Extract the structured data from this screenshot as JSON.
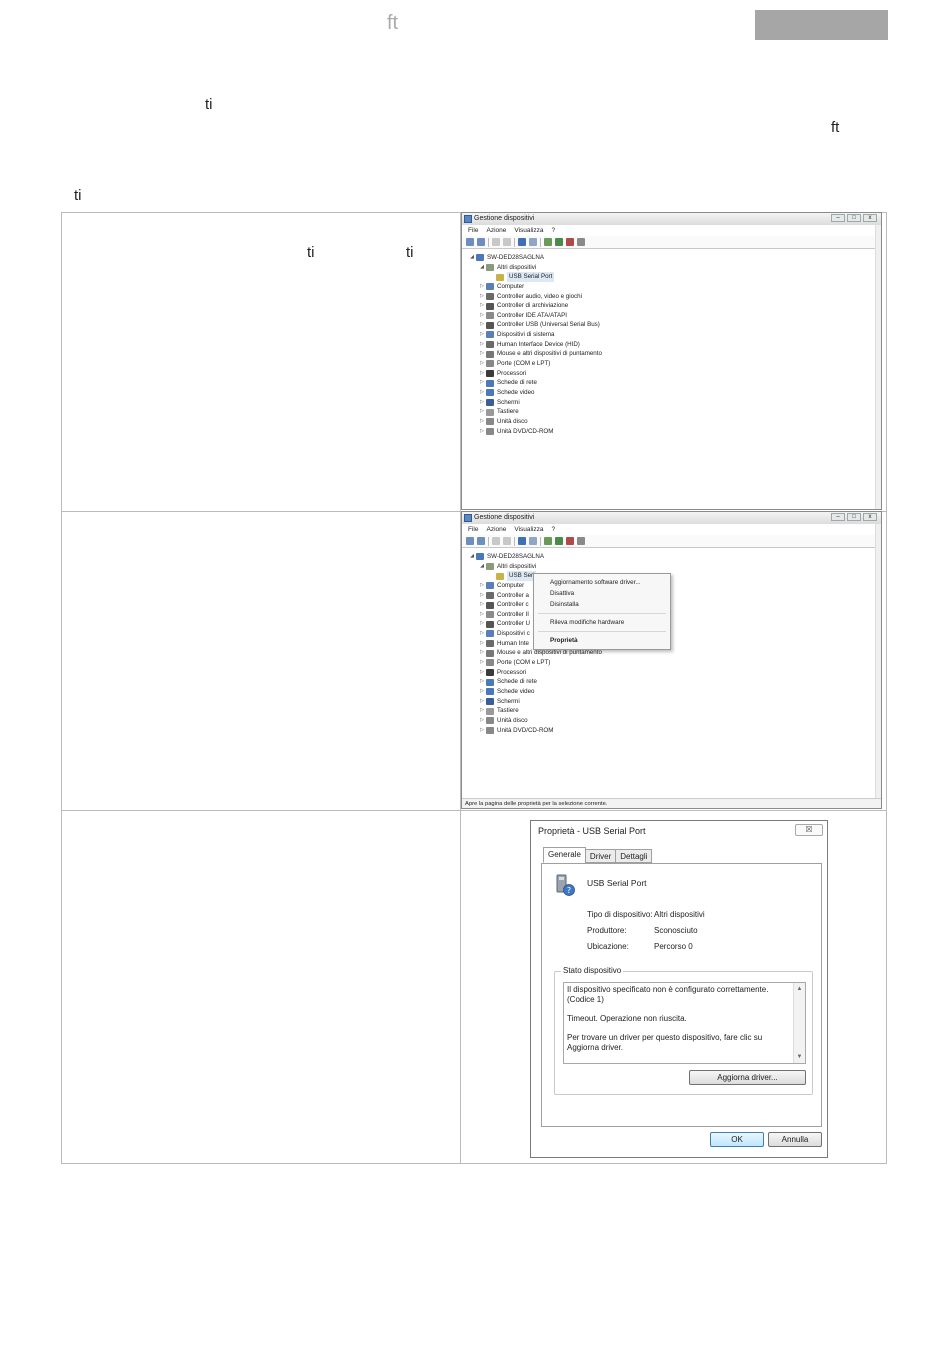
{
  "header": {
    "ft": "ft"
  },
  "fragments": {
    "ti1": "ti",
    "ft2": "ft",
    "ti2": "ti",
    "cell1_ti_a": "ti",
    "cell1_ti_b": "ti"
  },
  "window1": {
    "title": "Gestione dispositivi",
    "menu": [
      "File",
      "Azione",
      "Visualizza",
      "?"
    ],
    "tree": [
      {
        "level": 0,
        "toggle": "◢",
        "label": "SW-DED28SAGLNA",
        "color": "#4a78b8"
      },
      {
        "level": 1,
        "toggle": "◢",
        "label": "Altri dispositivi",
        "color": "#8a9a7a"
      },
      {
        "level": 2,
        "toggle": "",
        "label": "USB Serial Port",
        "color": "#c9b347"
      },
      {
        "level": 1,
        "toggle": "▷",
        "label": "Computer",
        "color": "#5a7fb8"
      },
      {
        "level": 1,
        "toggle": "▷",
        "label": "Controller audio, video e giochi",
        "color": "#6a6a6a"
      },
      {
        "level": 1,
        "toggle": "▷",
        "label": "Controller di archiviazione",
        "color": "#555555"
      },
      {
        "level": 1,
        "toggle": "▷",
        "label": "Controller IDE ATA/ATAPI",
        "color": "#8a8a8a"
      },
      {
        "level": 1,
        "toggle": "▷",
        "label": "Controller USB (Universal Serial Bus)",
        "color": "#555555"
      },
      {
        "level": 1,
        "toggle": "▷",
        "label": "Dispositivi di sistema",
        "color": "#5a7fb8"
      },
      {
        "level": 1,
        "toggle": "▷",
        "label": "Human Interface Device (HID)",
        "color": "#6a6a6a"
      },
      {
        "level": 1,
        "toggle": "▷",
        "label": "Mouse e altri dispositivi di puntamento",
        "color": "#777777"
      },
      {
        "level": 1,
        "toggle": "▷",
        "label": "Porte (COM e LPT)",
        "color": "#888888"
      },
      {
        "level": 1,
        "toggle": "▷",
        "label": "Processori",
        "color": "#3a3a3a"
      },
      {
        "level": 1,
        "toggle": "▷",
        "label": "Schede di rete",
        "color": "#4a78b8"
      },
      {
        "level": 1,
        "toggle": "▷",
        "label": "Schede video",
        "color": "#4a78b8"
      },
      {
        "level": 1,
        "toggle": "▷",
        "label": "Schermi",
        "color": "#3a5f98"
      },
      {
        "level": 1,
        "toggle": "▷",
        "label": "Tastiere",
        "color": "#999999"
      },
      {
        "level": 1,
        "toggle": "▷",
        "label": "Unità disco",
        "color": "#888888"
      },
      {
        "level": 1,
        "toggle": "▷",
        "label": "Unità DVD/CD-ROM",
        "color": "#888888"
      }
    ]
  },
  "window2": {
    "title": "Gestione dispositivi",
    "menu": [
      "File",
      "Azione",
      "Visualizza",
      "?"
    ],
    "tree": [
      {
        "level": 0,
        "toggle": "◢",
        "label": "SW-DED28SAGLNA",
        "color": "#4a78b8"
      },
      {
        "level": 1,
        "toggle": "◢",
        "label": "Altri dispositivi",
        "color": "#8a9a7a"
      },
      {
        "level": 2,
        "toggle": "",
        "label": "USB Seri",
        "color": "#c9b347"
      },
      {
        "level": 1,
        "toggle": "▷",
        "label": "Computer",
        "color": "#5a7fb8"
      },
      {
        "level": 1,
        "toggle": "▷",
        "label": "Controller a",
        "color": "#6a6a6a"
      },
      {
        "level": 1,
        "toggle": "▷",
        "label": "Controller c",
        "color": "#555555"
      },
      {
        "level": 1,
        "toggle": "▷",
        "label": "Controller II",
        "color": "#8a8a8a"
      },
      {
        "level": 1,
        "toggle": "▷",
        "label": "Controller U",
        "color": "#555555"
      },
      {
        "level": 1,
        "toggle": "▷",
        "label": "Dispositivi c",
        "color": "#5a7fb8"
      },
      {
        "level": 1,
        "toggle": "▷",
        "label": "Human Inte",
        "color": "#6a6a6a"
      },
      {
        "level": 1,
        "toggle": "▷",
        "label": "Mouse e altri dispositivi di puntamento",
        "color": "#777777"
      },
      {
        "level": 1,
        "toggle": "▷",
        "label": "Porte (COM e LPT)",
        "color": "#888888"
      },
      {
        "level": 1,
        "toggle": "▷",
        "label": "Processori",
        "color": "#3a3a3a"
      },
      {
        "level": 1,
        "toggle": "▷",
        "label": "Schede di rete",
        "color": "#4a78b8"
      },
      {
        "level": 1,
        "toggle": "▷",
        "label": "Schede video",
        "color": "#4a78b8"
      },
      {
        "level": 1,
        "toggle": "▷",
        "label": "Schermi",
        "color": "#3a5f98"
      },
      {
        "level": 1,
        "toggle": "▷",
        "label": "Tastiere",
        "color": "#999999"
      },
      {
        "level": 1,
        "toggle": "▷",
        "label": "Unità disco",
        "color": "#888888"
      },
      {
        "level": 1,
        "toggle": "▷",
        "label": "Unità DVD/CD-ROM",
        "color": "#888888"
      }
    ],
    "context_menu": {
      "update": "Aggiornamento software driver...",
      "disable": "Disattiva",
      "uninstall": "Disinstalla",
      "scan": "Rileva modifiche hardware",
      "properties": "Proprietà"
    },
    "status": "Apre la pagina delle proprietà per la selezione corrente."
  },
  "dialog": {
    "title": "Proprietà - USB Serial Port",
    "close": "☒",
    "tabs": [
      "Generale",
      "Driver",
      "Dettagli"
    ],
    "device_name": "USB Serial Port",
    "type_label": "Tipo di dispositivo:",
    "type_value": "Altri dispositivi",
    "manufacturer_label": "Produttore:",
    "manufacturer_value": "Sconosciuto",
    "location_label": "Ubicazione:",
    "location_value": "Percorso 0",
    "status_legend": "Stato dispositivo",
    "status_line1": "Il dispositivo specificato non è configurato correttamente. (Codice 1)",
    "status_line2": "Timeout. Operazione non riuscita.",
    "status_line3": "Per trovare un driver per questo dispositivo, fare clic su Aggiorna driver.",
    "update_button": "Aggiorna driver...",
    "ok_button": "OK",
    "cancel_button": "Annulla"
  }
}
